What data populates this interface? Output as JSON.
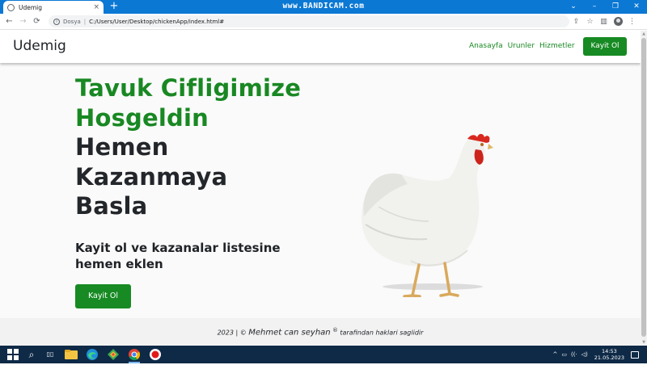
{
  "browser": {
    "tab_title": "Udemig",
    "tab_close": "×",
    "new_tab": "+",
    "watermark": "www.BANDICAM.com",
    "window_controls": [
      "⌄",
      "–",
      "❐",
      "✕"
    ],
    "nav": {
      "back": "←",
      "forward": "→",
      "reload": "⟳"
    },
    "security_label": "Dosya",
    "url": "C:/Users/User/Desktop/chickenApp/index.html#",
    "toolbar_icons": {
      "share": "⇪",
      "bookmark": "☆",
      "sidepanel": "▥",
      "menu": "⋮"
    }
  },
  "site": {
    "brand": "Udemig",
    "nav_links": [
      "Anasayfa",
      "Urunler",
      "Hizmetler"
    ],
    "nav_button": "Kayit Ol",
    "hero_lines": [
      "Tavuk Cifligimize",
      "Hosgeldin",
      "Hemen",
      "Kazanmaya",
      "Basla"
    ],
    "subheading": "Kayit ol ve kazanalar listesine hemen eklen",
    "cta_button": "Kayit Ol",
    "footer": {
      "prefix": "2023 | ©",
      "author": "Mehmet can seyhan",
      "registered": "®",
      "suffix": "tarafindan haklari saglidir"
    }
  },
  "taskbar": {
    "tray": {
      "chevron": "^",
      "battery": "▭",
      "wifi": "((·",
      "volume": "◁)"
    },
    "time": "14:53",
    "date": "21.05.2023"
  },
  "colors": {
    "accent_green": "#198823",
    "button_green": "#178a23",
    "titlebar_blue": "#0b78d4",
    "taskbar": "#0e2a47"
  }
}
